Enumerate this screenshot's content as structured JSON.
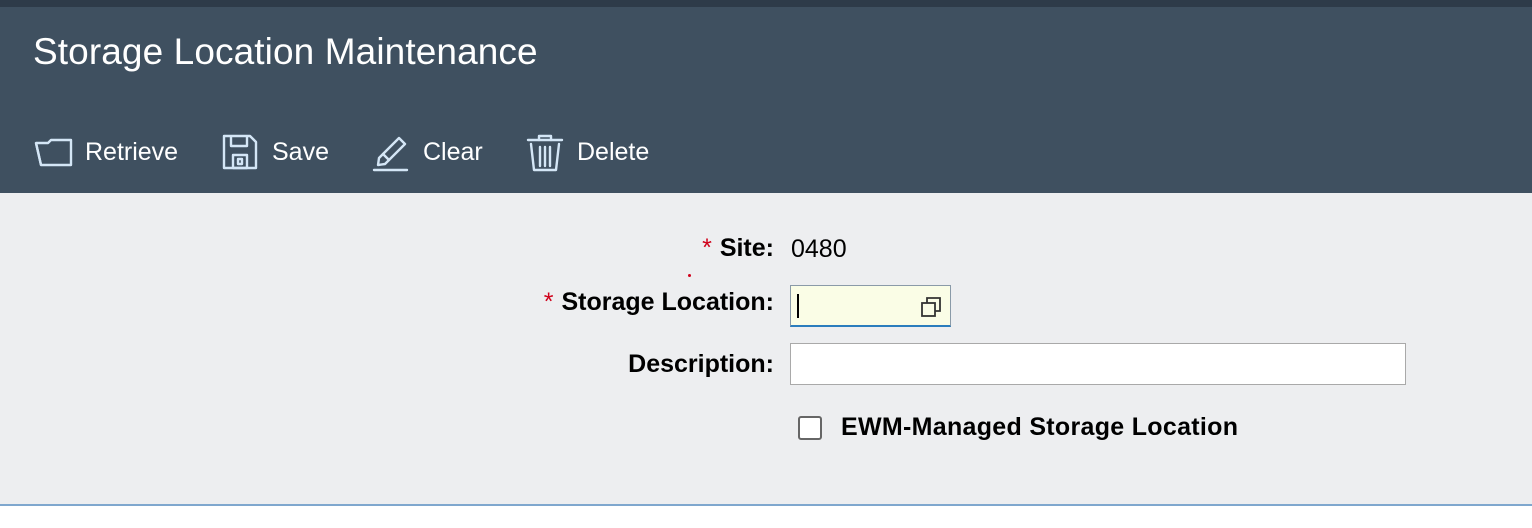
{
  "header": {
    "title": "Storage Location Maintenance"
  },
  "toolbar": {
    "retrieve": {
      "label": "Retrieve",
      "icon": "open-folder-icon"
    },
    "save": {
      "label": "Save",
      "icon": "floppy-disk-icon"
    },
    "clear": {
      "label": "Clear",
      "icon": "eraser-icon"
    },
    "delete": {
      "label": "Delete",
      "icon": "trash-icon"
    }
  },
  "form": {
    "required_marker": "*",
    "site": {
      "label": "Site:",
      "value": "0480"
    },
    "storage_location": {
      "label": "Storage Location:",
      "value": ""
    },
    "description": {
      "label": "Description:",
      "value": ""
    },
    "ewm_managed": {
      "label": "EWM-Managed Storage Location",
      "checked": false
    }
  },
  "colors": {
    "header_bg": "#3f5060",
    "content_bg": "#edeef0",
    "required": "#d0021b",
    "focus_border": "#2b7dbd",
    "active_field_bg": "#fafde6"
  }
}
